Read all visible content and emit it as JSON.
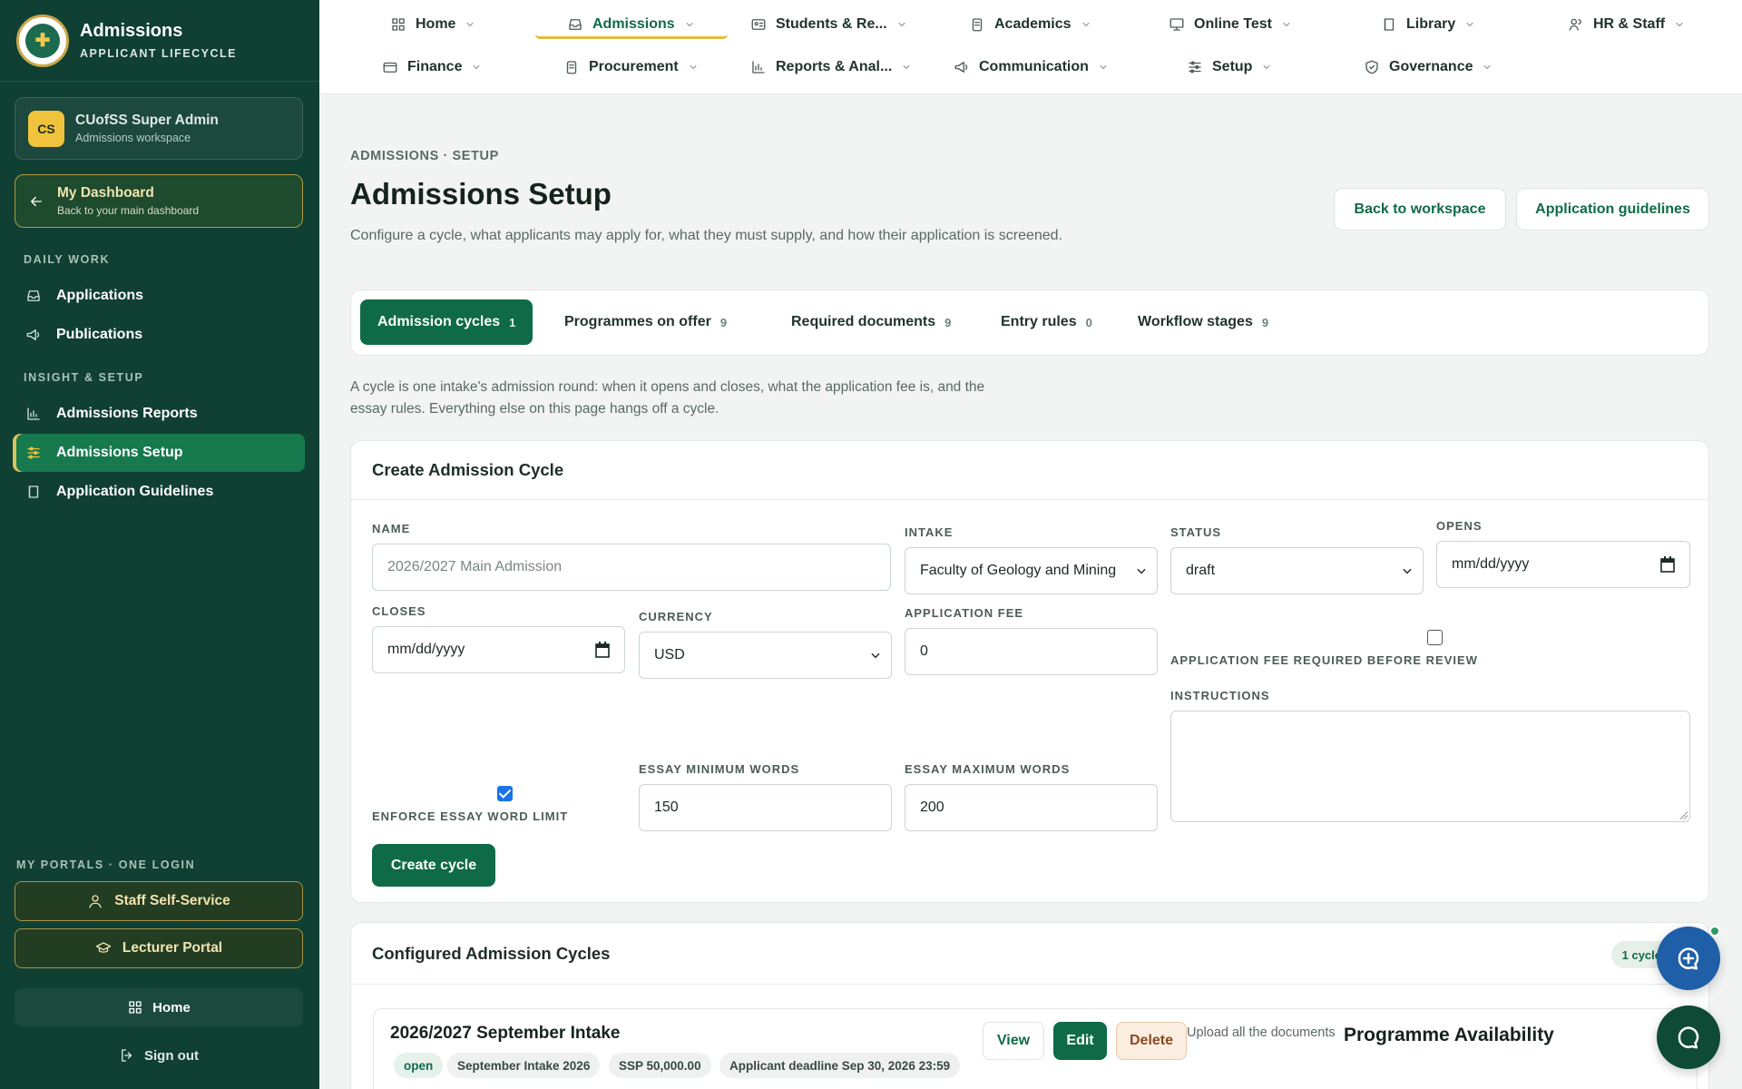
{
  "brand": {
    "title": "Admissions",
    "subtitle": "APPLICANT LIFECYCLE",
    "logo_icon": "crest-logo"
  },
  "user": {
    "initials": "CS",
    "name": "CUofSS Super Admin",
    "workspace": "Admissions workspace"
  },
  "dashboard": {
    "title": "My Dashboard",
    "subtitle": "Back to your main dashboard"
  },
  "sidebar": {
    "daily_label": "DAILY WORK",
    "insight_label": "INSIGHT & SETUP",
    "items": [
      {
        "label": "Applications",
        "icon": "inbox-icon"
      },
      {
        "label": "Publications",
        "icon": "megaphone-icon"
      },
      {
        "label": "Admissions Reports",
        "icon": "bar-chart-icon"
      },
      {
        "label": "Admissions Setup",
        "icon": "sliders-icon",
        "active": true
      },
      {
        "label": "Application Guidelines",
        "icon": "book-icon"
      }
    ],
    "portals_label": "MY PORTALS · ONE LOGIN",
    "portals": [
      {
        "label": "Staff Self-Service",
        "icon": "user-icon"
      },
      {
        "label": "Lecturer Portal",
        "icon": "graduation-cap-icon"
      }
    ],
    "home": "Home",
    "signout": "Sign out"
  },
  "topnav": [
    {
      "label": "Home",
      "icon": "grid-icon"
    },
    {
      "label": "Admissions",
      "icon": "inbox-icon",
      "active": true
    },
    {
      "label": "Students & Re...",
      "icon": "id-card-icon"
    },
    {
      "label": "Academics",
      "icon": "clipboard-icon"
    },
    {
      "label": "Online Test",
      "icon": "monitor-icon"
    },
    {
      "label": "Library",
      "icon": "book-icon"
    },
    {
      "label": "HR & Staff",
      "icon": "users-icon"
    },
    {
      "label": "Finance",
      "icon": "wallet-icon"
    },
    {
      "label": "Procurement",
      "icon": "clipboard-icon"
    },
    {
      "label": "Reports & Anal...",
      "icon": "bar-chart-icon"
    },
    {
      "label": "Communication",
      "icon": "megaphone-icon"
    },
    {
      "label": "Setup",
      "icon": "sliders-icon"
    },
    {
      "label": "Governance",
      "icon": "shield-icon"
    }
  ],
  "page": {
    "breadcrumb": "ADMISSIONS · SETUP",
    "title": "Admissions Setup",
    "description": "Configure a cycle, what applicants may apply for, what they must supply, and how their application is screened.",
    "back_button": "Back to workspace",
    "guidelines_button": "Application guidelines"
  },
  "tabs": [
    {
      "label": "Admission cycles",
      "count": "1",
      "active": true
    },
    {
      "label": "Programmes on offer",
      "count": "9"
    },
    {
      "label": "Required documents",
      "count": "9"
    },
    {
      "label": "Entry rules",
      "count": "0"
    },
    {
      "label": "Workflow stages",
      "count": "9"
    }
  ],
  "note": "A cycle is one intake's admission round: when it opens and closes, what the application fee is, and the essay rules. Everything else on this page hangs off a cycle.",
  "form": {
    "title": "Create Admission Cycle",
    "name_label": "NAME",
    "name_placeholder": "2026/2027 Main Admission",
    "intake_label": "INTAKE",
    "intake_value": "Faculty of Geology and Mining",
    "status_label": "STATUS",
    "status_value": "draft",
    "opens_label": "OPENS",
    "opens_value": "mm/dd/yyyy",
    "closes_label": "CLOSES",
    "closes_value": "mm/dd/yyyy",
    "currency_label": "CURRENCY",
    "currency_value": "USD",
    "fee_label": "APPLICATION FEE",
    "fee_value": "0",
    "fee_required_label": "APPLICATION FEE REQUIRED BEFORE REVIEW",
    "fee_required_checked": false,
    "instructions_label": "INSTRUCTIONS",
    "enforce_label": "ENFORCE ESSAY WORD LIMIT",
    "enforce_checked": true,
    "essay_min_label": "ESSAY MINIMUM WORDS",
    "essay_min_value": "150",
    "essay_max_label": "ESSAY MAXIMUM WORDS",
    "essay_max_value": "200",
    "submit": "Create cycle"
  },
  "configured": {
    "title": "Configured Admission Cycles",
    "count": "1 cycle",
    "cycle": {
      "name": "2026/2027 September Intake",
      "chips": [
        "open",
        "September Intake 2026",
        "SSP 50,000.00",
        "Applicant deadline Sep 30, 2026 23:59"
      ],
      "view": "View",
      "edit": "Edit",
      "delete": "Delete",
      "upload_text": "Upload all the documents",
      "availability": "Programme Availability"
    }
  },
  "colors": {
    "sidebar": "#103f33",
    "accent": "#0f6b47",
    "gold": "#f0c33c"
  }
}
